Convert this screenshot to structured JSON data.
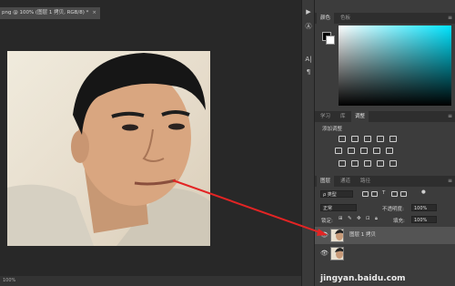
{
  "document_tab": {
    "title": "png @ 100% (图层 1 拷贝, RGB/8) *",
    "close": "×"
  },
  "tool_strip": {
    "items": [
      "▶",
      "Ⓐ",
      "A|",
      "¶"
    ]
  },
  "color_panel": {
    "tabs": [
      "颜色",
      "色板"
    ]
  },
  "adjust_panel": {
    "tabs": [
      "学习",
      "库",
      "调整"
    ],
    "heading": "添加调整"
  },
  "layers_panel": {
    "tabs": [
      "图层",
      "通道",
      "路径"
    ],
    "filter_label": "ρ 类型",
    "blend_mode": "正常",
    "opacity_label": "不透明度:",
    "opacity_value": "100%",
    "lock_label": "锁定:",
    "fill_label": "填充:",
    "fill_value": "100%",
    "layers": [
      {
        "name": "图层 1 拷贝",
        "selected": true
      },
      {
        "name": "",
        "selected": false
      }
    ]
  },
  "status_bar": {
    "text": "100%"
  },
  "watermark": "jingyan.baidu.com",
  "colors": {
    "accent_arrow": "#e32424",
    "panel_bg": "#3c3c3c",
    "canvas_bg": "#282828"
  }
}
